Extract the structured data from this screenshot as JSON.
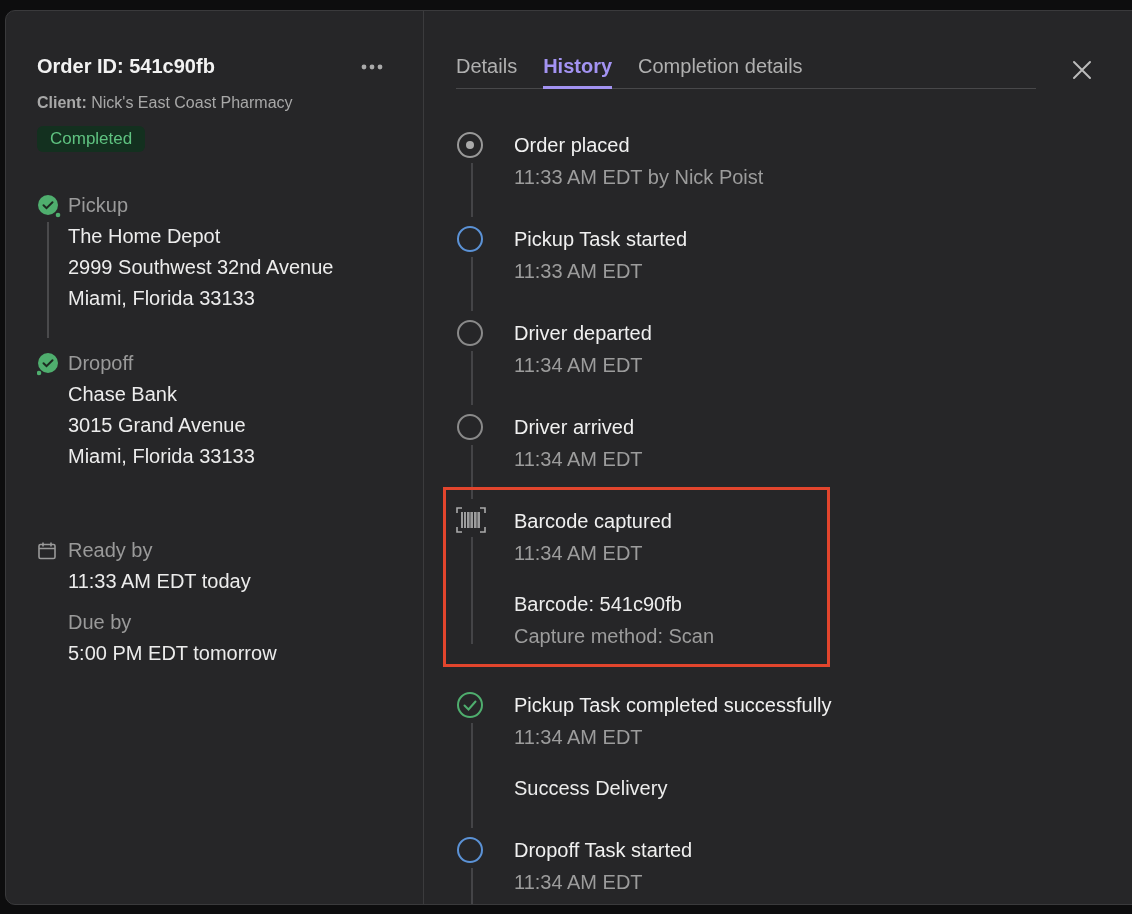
{
  "order": {
    "title": "Order ID: 541c90fb",
    "client": "**Client:** Nick's East Coast Pharmacy",
    "status": "Completed"
  },
  "stops": [
    {
      "label": "Pickup",
      "done": true,
      "lines": [
        "The Home Depot",
        "2999 Southwest 32nd Avenue",
        "Miami, Florida 33133"
      ]
    },
    {
      "label": "Dropoff",
      "done": true,
      "lines": [
        "Chase Bank",
        "3015 Grand Avenue",
        "Miami, Florida 33133"
      ]
    }
  ],
  "schedule": [
    {
      "kind": "calendar",
      "label": "Ready by",
      "value": "11:33 AM EDT today"
    },
    {
      "kind": "plain",
      "label": "Due by",
      "value": "5:00 PM EDT tomorrow"
    }
  ],
  "tabs": [
    {
      "label": "Details",
      "selected": false
    },
    {
      "label": "History",
      "selected": true
    },
    {
      "label": "Completion details",
      "selected": false
    }
  ],
  "history": [
    {
      "kind": "placed",
      "title": "Order placed",
      "time": "11:33 AM EDT by Nick Poist",
      "highlighted": false
    },
    {
      "kind": "started",
      "title": "Pickup Task started",
      "time": "11:33 AM EDT",
      "highlighted": false
    },
    {
      "kind": "waypoint",
      "title": "Driver departed",
      "time": "11:34 AM EDT",
      "highlighted": false
    },
    {
      "kind": "waypoint",
      "title": "Driver arrived",
      "time": "11:34 AM EDT",
      "highlighted": false
    },
    {
      "kind": "barcode",
      "title": "Barcode captured",
      "time": "11:34 AM EDT",
      "highlighted": true,
      "details": [
        {
          "text": "Barcode: 541c90fb",
          "muted": false
        },
        {
          "text": "Capture method: Scan",
          "muted": true
        }
      ]
    },
    {
      "kind": "completed",
      "title": "Pickup Task completed successfully",
      "time": "11:34 AM EDT",
      "highlighted": false,
      "details": [
        {
          "text": "Success Delivery",
          "muted": false
        }
      ]
    },
    {
      "kind": "started",
      "title": "Dropoff Task started",
      "time": "11:34 AM EDT",
      "highlighted": false
    }
  ]
}
